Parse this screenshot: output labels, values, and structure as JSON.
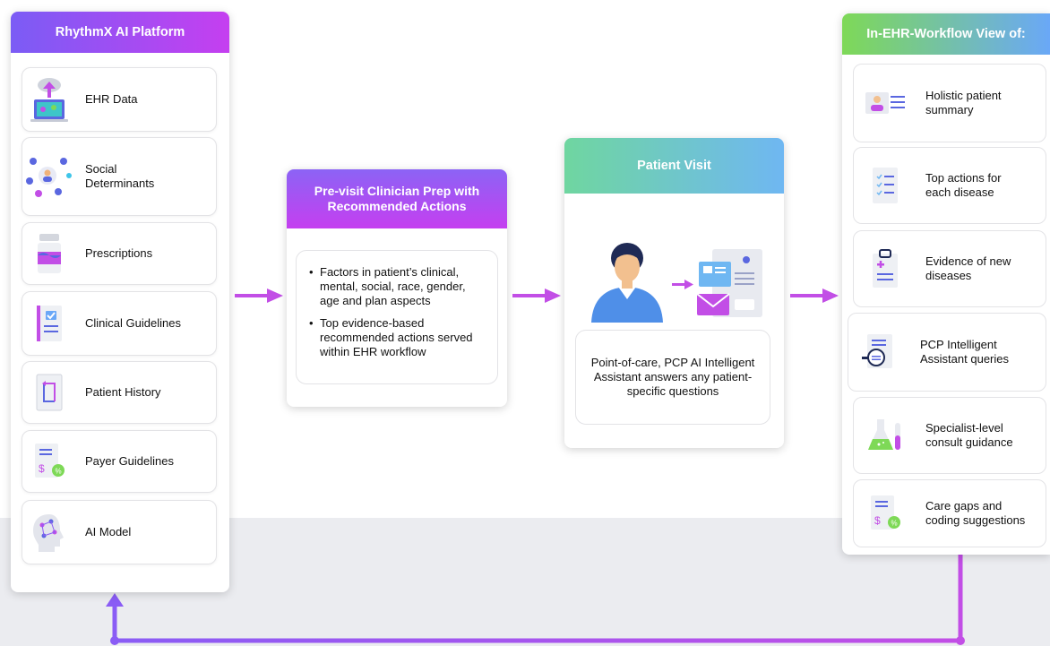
{
  "platform": {
    "title": "RhythmX AI Platform",
    "items": [
      {
        "label": "EHR Data",
        "icon": "cloud-laptop-icon"
      },
      {
        "label": "Social Determinants",
        "icon": "social-network-icon"
      },
      {
        "label": "Prescriptions",
        "icon": "pill-bottle-icon"
      },
      {
        "label": "Clinical Guidelines",
        "icon": "guidelines-document-icon"
      },
      {
        "label": "Patient History",
        "icon": "history-document-icon"
      },
      {
        "label": "Payer Guidelines",
        "icon": "payer-document-icon"
      },
      {
        "label": "AI Model",
        "icon": "ai-brain-icon"
      }
    ]
  },
  "previsit": {
    "title": "Pre-visit Clinician Prep with Recommended Actions",
    "bullets": [
      "Factors in patient’s clinical, mental, social, race, gender, age and plan aspects",
      "Top evidence-based recommended actions served within EHR workflow"
    ]
  },
  "visit": {
    "title": "Patient Visit",
    "description": "Point-of-care, PCP AI Intelligent Assistant answers any patient-specific questions"
  },
  "ehr_view": {
    "title": "In-EHR-Workflow View of:",
    "items": [
      {
        "label": "Holistic patient\nsummary",
        "icon": "patient-card-icon"
      },
      {
        "label": "Top actions for\neach disease",
        "icon": "checklist-icon"
      },
      {
        "label": "Evidence of new\ndiseases",
        "icon": "clipboard-medical-icon"
      },
      {
        "label": "PCP Intelligent\nAssistant queries",
        "icon": "magnifier-document-icon"
      },
      {
        "label": "Specialist-level\nconsult guidance",
        "icon": "lab-flask-icon"
      },
      {
        "label": "Care gaps and\ncoding suggestions",
        "icon": "billing-document-icon"
      }
    ]
  },
  "colors": {
    "purple_arrow": "#c24ee6",
    "platform_header": [
      "#7b5cf5",
      "#c53ff0"
    ],
    "previsit_header": [
      "#c53ff0",
      "#8c63f5"
    ],
    "visit_header": [
      "#6fd6a0",
      "#6fb7f2"
    ],
    "ehr_header": [
      "#7ed957",
      "#6aa8f7"
    ]
  }
}
